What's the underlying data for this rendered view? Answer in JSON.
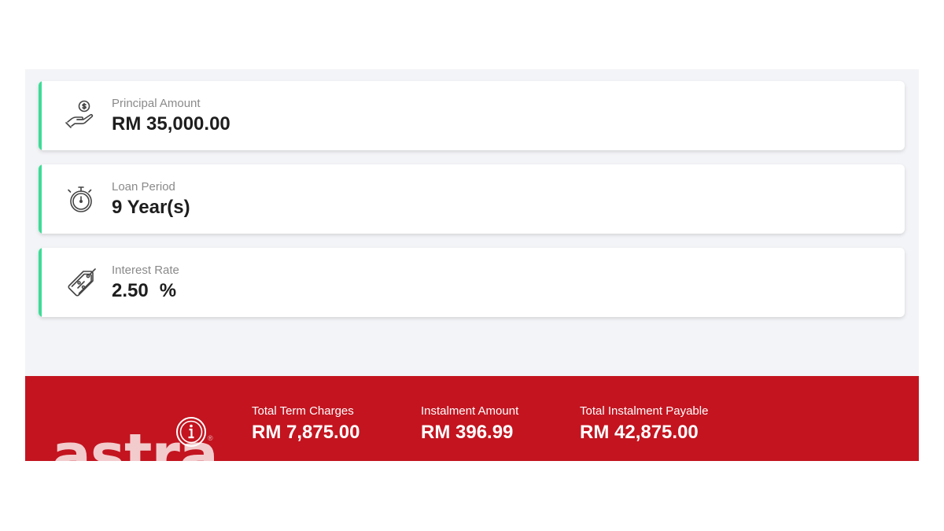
{
  "cards": [
    {
      "icon": "hand-dollar-icon",
      "label": "Principal Amount",
      "value": "RM 35,000.00"
    },
    {
      "icon": "stopwatch-icon",
      "label": "Loan Period",
      "value": "9 Year(s)"
    },
    {
      "icon": "percent-tag-icon",
      "label": "Interest Rate",
      "value": "2.50",
      "unit": "%"
    }
  ],
  "summary": [
    {
      "label": "Total Term Charges",
      "value": "RM 7,875.00"
    },
    {
      "label": "Instalment Amount",
      "value": "RM 396.99"
    },
    {
      "label": "Total Instalment Payable",
      "value": "RM 42,875.00"
    }
  ],
  "summary_icon": "info-icon",
  "watermark": "astra",
  "colors": {
    "accent": "#3ddc97",
    "footer_bg": "#c3141f",
    "panel_bg": "#f3f4f7"
  }
}
